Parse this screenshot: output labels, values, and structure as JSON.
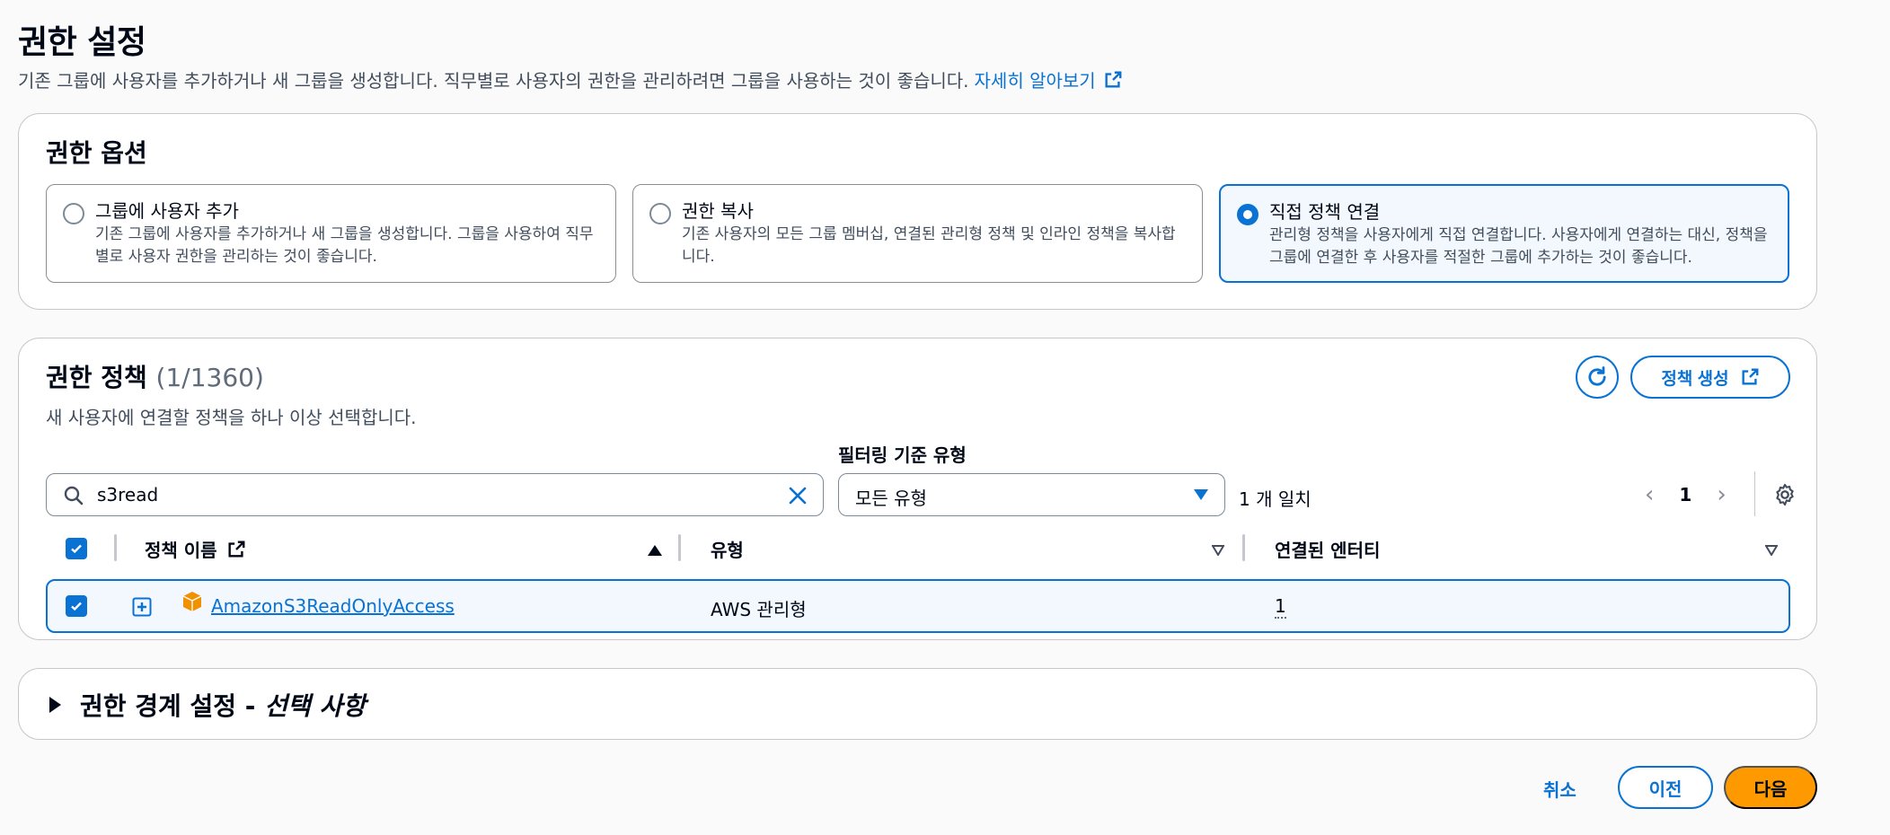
{
  "page": {
    "title": "권한 설정",
    "description": "기존 그룹에 사용자를 추가하거나 새 그룹을 생성합니다. 직무별로 사용자의 권한을 관리하려면 그룹을 사용하는 것이 좋습니다.",
    "learn_more": "자세히 알아보기"
  },
  "options": {
    "title": "권한 옵션",
    "tiles": [
      {
        "label": "그룹에 사용자 추가",
        "description": "기존 그룹에 사용자를 추가하거나 새 그룹을 생성합니다. 그룹을 사용하여 직무별로 사용자 권한을 관리하는 것이 좋습니다.",
        "selected": false
      },
      {
        "label": "권한 복사",
        "description": "기존 사용자의 모든 그룹 멤버십, 연결된 관리형 정책 및 인라인 정책을 복사합니다.",
        "selected": false
      },
      {
        "label": "직접 정책 연결",
        "description": "관리형 정책을 사용자에게 직접 연결합니다. 사용자에게 연결하는 대신, 정책을 그룹에 연결한 후 사용자를 적절한 그룹에 추가하는 것이 좋습니다.",
        "selected": true
      }
    ]
  },
  "policies": {
    "title": "권한 정책",
    "count": "(1/1360)",
    "description": "새 사용자에 연결할 정책을 하나 이상 선택합니다.",
    "create_button": "정책 생성",
    "filter_label": "필터링 기준 유형",
    "search_value": "s3read",
    "type_select": "모든 유형",
    "matches": "1 개 일치",
    "current_page": "1",
    "columns": {
      "name": "정책 이름",
      "type": "유형",
      "entities": "연결된 엔터티"
    },
    "rows": [
      {
        "name": "AmazonS3ReadOnlyAccess",
        "type": "AWS 관리형",
        "entities": "1",
        "selected": true
      }
    ]
  },
  "boundary": {
    "title": "권한 경계 설정 - ",
    "optional": "선택 사항"
  },
  "footer": {
    "cancel": "취소",
    "previous": "이전",
    "next": "다음"
  },
  "colors": {
    "accent": "#0972d3",
    "primary_button": "#ff9900",
    "selected_bg": "#f2f8fd"
  }
}
